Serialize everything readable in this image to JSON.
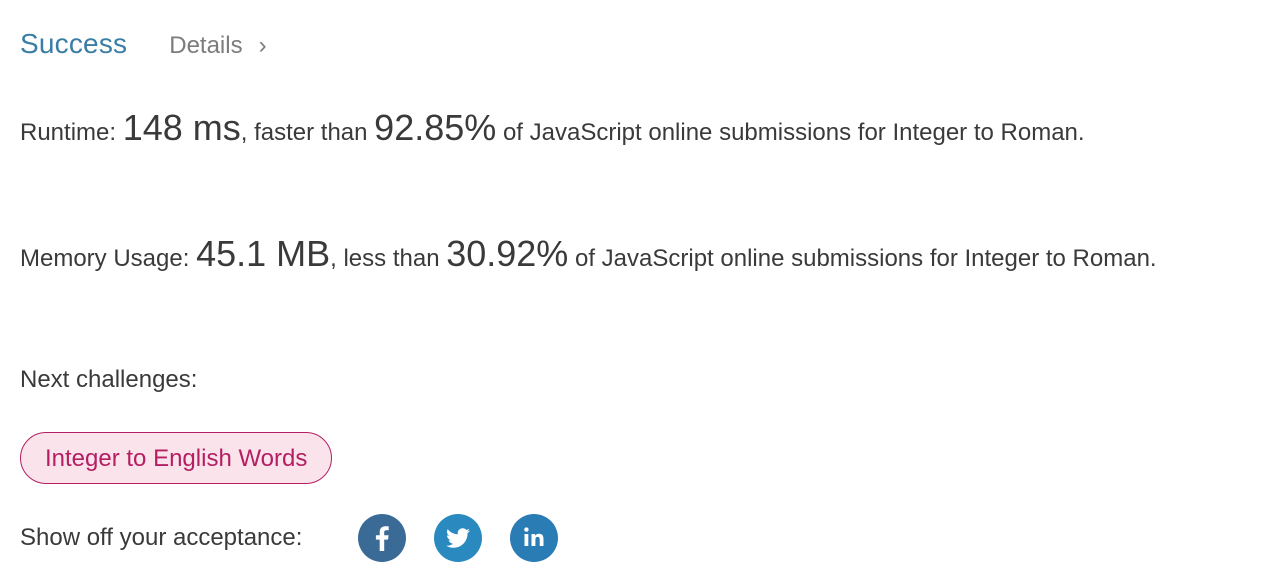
{
  "header": {
    "status": "Success",
    "details_label": "Details",
    "details_chevron": "›"
  },
  "runtime": {
    "label": "Runtime: ",
    "value": "148 ms",
    "middle": ", faster than ",
    "percent": "92.85%",
    "suffix": " of JavaScript online submissions for Integer to Roman."
  },
  "memory": {
    "label": "Memory Usage: ",
    "value": "45.1 MB",
    "middle": ", less than ",
    "percent": "30.92%",
    "suffix": " of JavaScript online submissions for Integer to Roman."
  },
  "next_challenges": {
    "label": "Next challenges:",
    "items": [
      {
        "label": "Integer to English Words"
      }
    ]
  },
  "share": {
    "label": "Show off your acceptance:",
    "icons": [
      {
        "name": "facebook-icon",
        "color": "#3a6b96"
      },
      {
        "name": "twitter-icon",
        "color": "#2a8ac0"
      },
      {
        "name": "linkedin-icon",
        "color": "#2a7cb5"
      }
    ]
  },
  "colors": {
    "success": "#3a7ea6",
    "tag_border": "#b31f62",
    "tag_background": "#fbe3ec"
  }
}
